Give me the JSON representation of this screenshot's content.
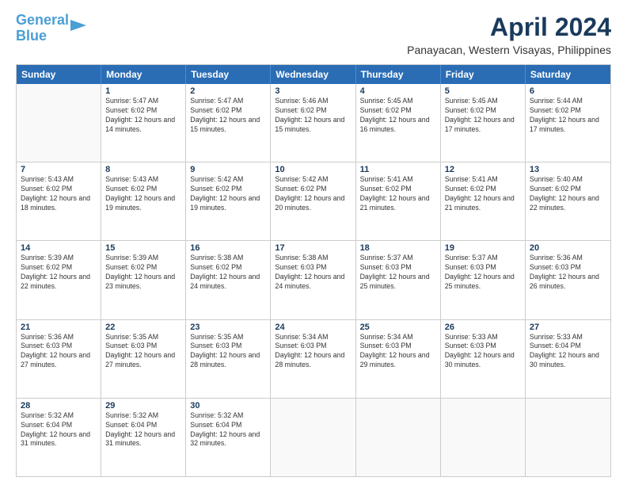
{
  "logo": {
    "line1": "General",
    "line2": "Blue"
  },
  "title": "April 2024",
  "subtitle": "Panayacan, Western Visayas, Philippines",
  "days_of_week": [
    "Sunday",
    "Monday",
    "Tuesday",
    "Wednesday",
    "Thursday",
    "Friday",
    "Saturday"
  ],
  "weeks": [
    [
      {
        "day": "",
        "sunrise": "",
        "sunset": "",
        "daylight": ""
      },
      {
        "day": "1",
        "sunrise": "Sunrise: 5:47 AM",
        "sunset": "Sunset: 6:02 PM",
        "daylight": "Daylight: 12 hours and 14 minutes."
      },
      {
        "day": "2",
        "sunrise": "Sunrise: 5:47 AM",
        "sunset": "Sunset: 6:02 PM",
        "daylight": "Daylight: 12 hours and 15 minutes."
      },
      {
        "day": "3",
        "sunrise": "Sunrise: 5:46 AM",
        "sunset": "Sunset: 6:02 PM",
        "daylight": "Daylight: 12 hours and 15 minutes."
      },
      {
        "day": "4",
        "sunrise": "Sunrise: 5:45 AM",
        "sunset": "Sunset: 6:02 PM",
        "daylight": "Daylight: 12 hours and 16 minutes."
      },
      {
        "day": "5",
        "sunrise": "Sunrise: 5:45 AM",
        "sunset": "Sunset: 6:02 PM",
        "daylight": "Daylight: 12 hours and 17 minutes."
      },
      {
        "day": "6",
        "sunrise": "Sunrise: 5:44 AM",
        "sunset": "Sunset: 6:02 PM",
        "daylight": "Daylight: 12 hours and 17 minutes."
      }
    ],
    [
      {
        "day": "7",
        "sunrise": "Sunrise: 5:43 AM",
        "sunset": "Sunset: 6:02 PM",
        "daylight": "Daylight: 12 hours and 18 minutes."
      },
      {
        "day": "8",
        "sunrise": "Sunrise: 5:43 AM",
        "sunset": "Sunset: 6:02 PM",
        "daylight": "Daylight: 12 hours and 19 minutes."
      },
      {
        "day": "9",
        "sunrise": "Sunrise: 5:42 AM",
        "sunset": "Sunset: 6:02 PM",
        "daylight": "Daylight: 12 hours and 19 minutes."
      },
      {
        "day": "10",
        "sunrise": "Sunrise: 5:42 AM",
        "sunset": "Sunset: 6:02 PM",
        "daylight": "Daylight: 12 hours and 20 minutes."
      },
      {
        "day": "11",
        "sunrise": "Sunrise: 5:41 AM",
        "sunset": "Sunset: 6:02 PM",
        "daylight": "Daylight: 12 hours and 21 minutes."
      },
      {
        "day": "12",
        "sunrise": "Sunrise: 5:41 AM",
        "sunset": "Sunset: 6:02 PM",
        "daylight": "Daylight: 12 hours and 21 minutes."
      },
      {
        "day": "13",
        "sunrise": "Sunrise: 5:40 AM",
        "sunset": "Sunset: 6:02 PM",
        "daylight": "Daylight: 12 hours and 22 minutes."
      }
    ],
    [
      {
        "day": "14",
        "sunrise": "Sunrise: 5:39 AM",
        "sunset": "Sunset: 6:02 PM",
        "daylight": "Daylight: 12 hours and 22 minutes."
      },
      {
        "day": "15",
        "sunrise": "Sunrise: 5:39 AM",
        "sunset": "Sunset: 6:02 PM",
        "daylight": "Daylight: 12 hours and 23 minutes."
      },
      {
        "day": "16",
        "sunrise": "Sunrise: 5:38 AM",
        "sunset": "Sunset: 6:02 PM",
        "daylight": "Daylight: 12 hours and 24 minutes."
      },
      {
        "day": "17",
        "sunrise": "Sunrise: 5:38 AM",
        "sunset": "Sunset: 6:03 PM",
        "daylight": "Daylight: 12 hours and 24 minutes."
      },
      {
        "day": "18",
        "sunrise": "Sunrise: 5:37 AM",
        "sunset": "Sunset: 6:03 PM",
        "daylight": "Daylight: 12 hours and 25 minutes."
      },
      {
        "day": "19",
        "sunrise": "Sunrise: 5:37 AM",
        "sunset": "Sunset: 6:03 PM",
        "daylight": "Daylight: 12 hours and 25 minutes."
      },
      {
        "day": "20",
        "sunrise": "Sunrise: 5:36 AM",
        "sunset": "Sunset: 6:03 PM",
        "daylight": "Daylight: 12 hours and 26 minutes."
      }
    ],
    [
      {
        "day": "21",
        "sunrise": "Sunrise: 5:36 AM",
        "sunset": "Sunset: 6:03 PM",
        "daylight": "Daylight: 12 hours and 27 minutes."
      },
      {
        "day": "22",
        "sunrise": "Sunrise: 5:35 AM",
        "sunset": "Sunset: 6:03 PM",
        "daylight": "Daylight: 12 hours and 27 minutes."
      },
      {
        "day": "23",
        "sunrise": "Sunrise: 5:35 AM",
        "sunset": "Sunset: 6:03 PM",
        "daylight": "Daylight: 12 hours and 28 minutes."
      },
      {
        "day": "24",
        "sunrise": "Sunrise: 5:34 AM",
        "sunset": "Sunset: 6:03 PM",
        "daylight": "Daylight: 12 hours and 28 minutes."
      },
      {
        "day": "25",
        "sunrise": "Sunrise: 5:34 AM",
        "sunset": "Sunset: 6:03 PM",
        "daylight": "Daylight: 12 hours and 29 minutes."
      },
      {
        "day": "26",
        "sunrise": "Sunrise: 5:33 AM",
        "sunset": "Sunset: 6:03 PM",
        "daylight": "Daylight: 12 hours and 30 minutes."
      },
      {
        "day": "27",
        "sunrise": "Sunrise: 5:33 AM",
        "sunset": "Sunset: 6:04 PM",
        "daylight": "Daylight: 12 hours and 30 minutes."
      }
    ],
    [
      {
        "day": "28",
        "sunrise": "Sunrise: 5:32 AM",
        "sunset": "Sunset: 6:04 PM",
        "daylight": "Daylight: 12 hours and 31 minutes."
      },
      {
        "day": "29",
        "sunrise": "Sunrise: 5:32 AM",
        "sunset": "Sunset: 6:04 PM",
        "daylight": "Daylight: 12 hours and 31 minutes."
      },
      {
        "day": "30",
        "sunrise": "Sunrise: 5:32 AM",
        "sunset": "Sunset: 6:04 PM",
        "daylight": "Daylight: 12 hours and 32 minutes."
      },
      {
        "day": "",
        "sunrise": "",
        "sunset": "",
        "daylight": ""
      },
      {
        "day": "",
        "sunrise": "",
        "sunset": "",
        "daylight": ""
      },
      {
        "day": "",
        "sunrise": "",
        "sunset": "",
        "daylight": ""
      },
      {
        "day": "",
        "sunrise": "",
        "sunset": "",
        "daylight": ""
      }
    ]
  ]
}
